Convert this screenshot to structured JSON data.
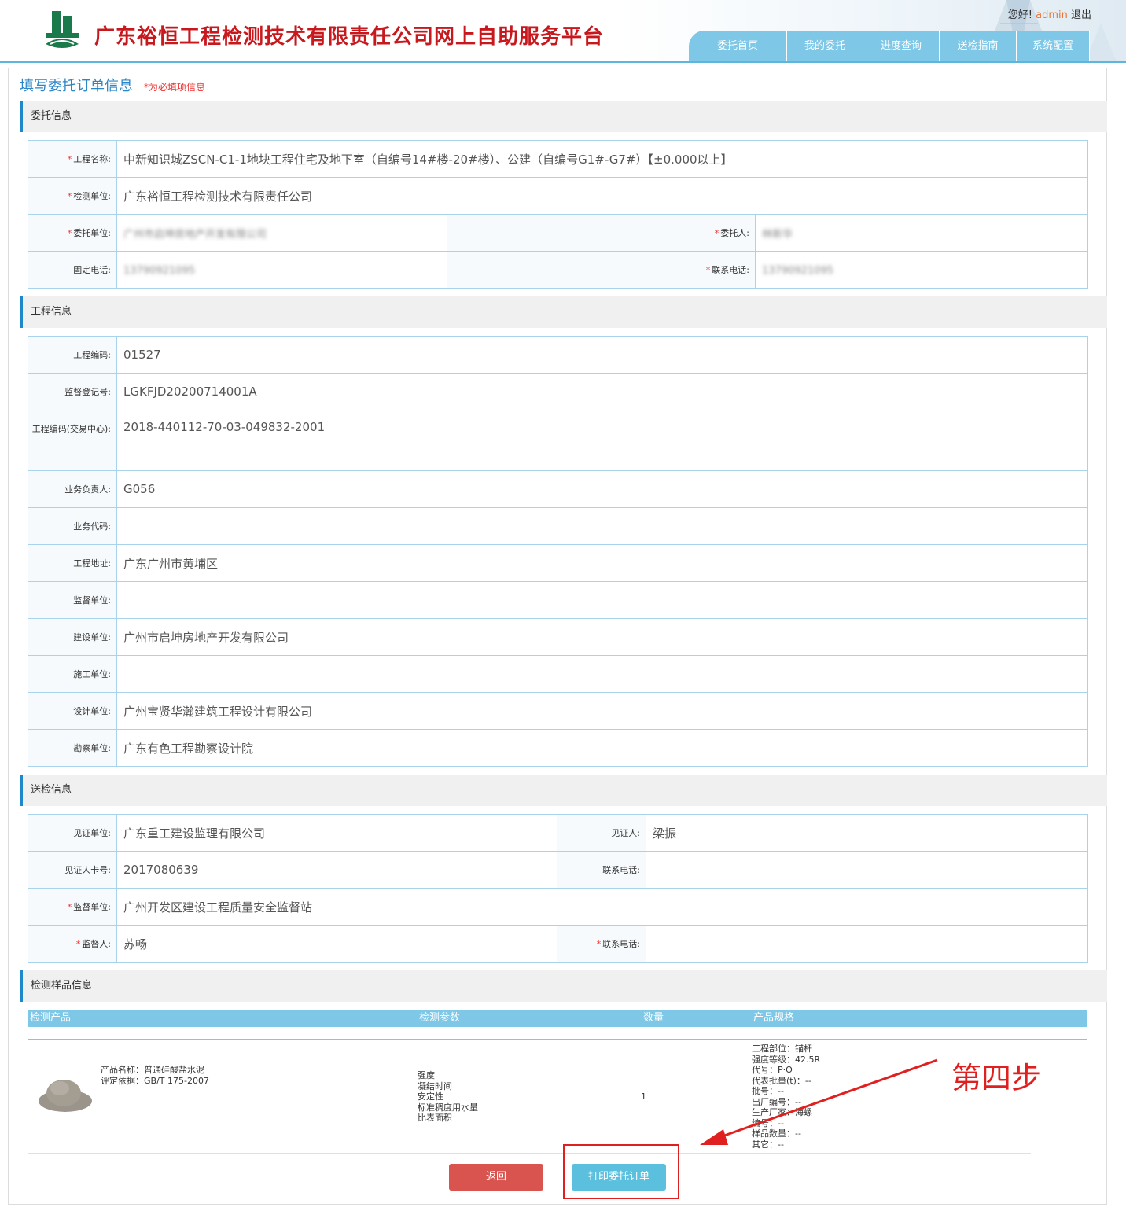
{
  "header": {
    "site_title": "广东裕恒工程检测技术有限责任公司网上自助服务平台",
    "greeting": "您好!",
    "username": "admin",
    "logout": "退出",
    "nav": [
      "委托首页",
      "我的委托",
      "进度查询",
      "送检指南",
      "系统配置"
    ]
  },
  "page": {
    "title": "填写委托订单信息",
    "required_note": "*为必填项信息"
  },
  "sections": {
    "commission": "委托信息",
    "project": "工程信息",
    "inspection": "送检信息",
    "samples": "检测样品信息"
  },
  "commission": {
    "project_name_label": "工程名称:",
    "project_name": "中新知识城ZSCN-C1-1地块工程住宅及地下室（自编号14#楼-20#楼）、公建（自编号G1#-G7#）【±0.000以上】",
    "test_unit_label": "检测单位:",
    "test_unit": "广东裕恒工程检测技术有限责任公司",
    "client_unit_label": "委托单位:",
    "client_unit": "广州市启坤房地产开发有限公司",
    "client_person_label": "委托人:",
    "client_person": "林新华",
    "fixed_phone_label": "固定电话:",
    "fixed_phone": "13790921095",
    "contact_phone_label": "联系电话:",
    "contact_phone": "13790921095"
  },
  "project": [
    {
      "label": "工程编码:",
      "value": "01527"
    },
    {
      "label": "监督登记号:",
      "value": "LGKFJD20200714001A"
    },
    {
      "label": "工程编码(交易中心):",
      "value": "2018-440112-70-03-049832-2001"
    },
    {
      "label": "业务负责人:",
      "value": "G056"
    },
    {
      "label": "业务代码:",
      "value": ""
    },
    {
      "label": "工程地址:",
      "value": "广东广州市黄埔区"
    },
    {
      "label": "监督单位:",
      "value": ""
    },
    {
      "label": "建设单位:",
      "value": "广州市启坤房地产开发有限公司"
    },
    {
      "label": "施工单位:",
      "value": ""
    },
    {
      "label": "设计单位:",
      "value": "广州宝贤华瀚建筑工程设计有限公司"
    },
    {
      "label": "勘察单位:",
      "value": "广东有色工程勘察设计院"
    }
  ],
  "inspection": {
    "witness_unit_label": "见证单位:",
    "witness_unit": "广东重工建设监理有限公司",
    "witness_label": "见证人:",
    "witness": "梁振",
    "witness_card_label": "见证人卡号:",
    "witness_card": "2017080639",
    "witness_phone_label": "联系电话:",
    "witness_phone": "",
    "supervision_unit_label": "监督单位:",
    "supervision_unit": "广州开发区建设工程质量安全监督站",
    "supervisor_label": "监督人:",
    "supervisor": "苏畅",
    "supervisor_phone_label": "联系电话:",
    "supervisor_phone": ""
  },
  "samples": {
    "columns": [
      "检测产品",
      "检测参数",
      "数量",
      "产品规格"
    ],
    "items": [
      {
        "product_name": "产品名称：普通硅酸盐水泥",
        "standard": "评定依据：GB/T 175-2007",
        "params": [
          "强度",
          "凝结时间",
          "安定性",
          "标准稠度用水量",
          "比表面积"
        ],
        "quantity": "1",
        "spec": [
          "工程部位：锚杆",
          "强度等级：42.5R",
          "代号：P·O",
          "代表批量(t)：--",
          "批号：--",
          "出厂编号：--",
          "生产厂家：海螺",
          "编号：--",
          "样品数量：--",
          "其它：--"
        ]
      }
    ]
  },
  "buttons": {
    "back": "返回",
    "print": "打印委托订单"
  },
  "annotation": {
    "text": "第四步",
    "color": "#e02020"
  },
  "colors": {
    "brand_red": "#c7181e",
    "nav_blue": "#7ec7e6",
    "accent_blue": "#1e88c8",
    "back_button": "#d9534f",
    "print_button": "#5bc0de"
  }
}
